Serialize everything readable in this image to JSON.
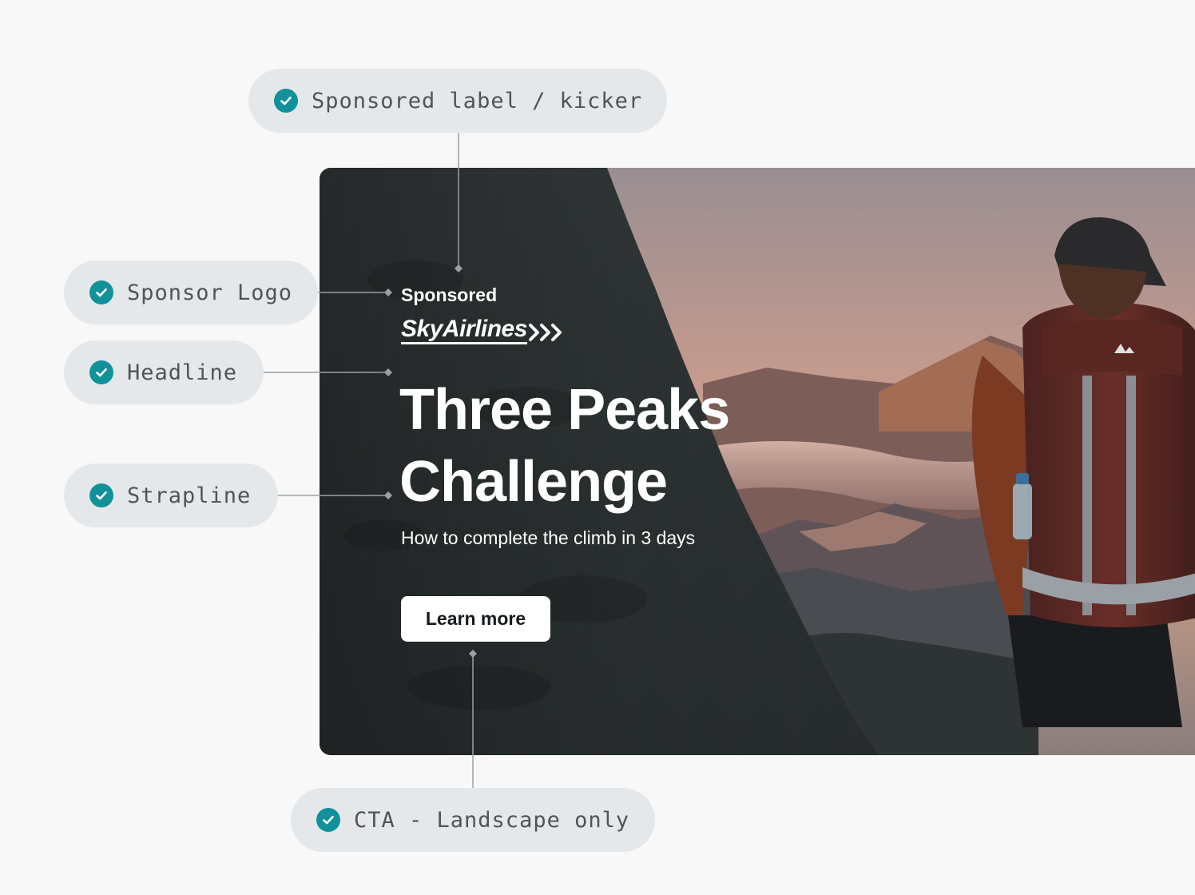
{
  "annotations": {
    "kicker_label": "Sponsored label / kicker",
    "logo_label": "Sponsor Logo",
    "headline_label": "Headline",
    "strapline_label": "Strapline",
    "cta_label": "CTA - Landscape only",
    "check_icon": "check-circle-icon",
    "check_color": "#11929b"
  },
  "ad": {
    "kicker": "Sponsored",
    "sponsor_logo_text": "SkyAirlines",
    "headline": "Three Peaks Challenge",
    "strapline": "How to complete the climb in 3 days",
    "cta_label": "Learn more",
    "photo": "hiker-with-backpack-overlooking-mountains-at-sunset"
  }
}
